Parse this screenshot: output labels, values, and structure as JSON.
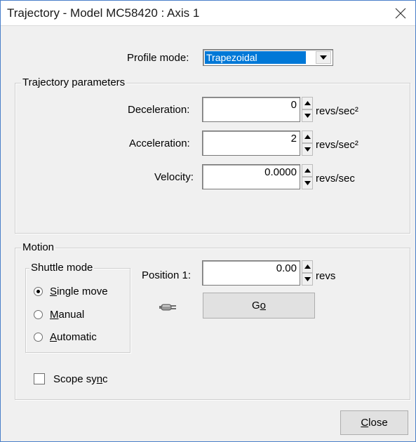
{
  "window": {
    "title": "Trajectory - Model MC58420 :  Axis 1",
    "close_glyph": "✕",
    "accent_color": "#0078d7"
  },
  "profile": {
    "label": "Profile mode:",
    "value": "Trapezoidal",
    "dropdown_icon": "chevron-down-icon"
  },
  "trajectory": {
    "group_title": "Trajectory parameters",
    "deceleration": {
      "label": "Deceleration:",
      "value": "0",
      "unit": "revs/sec²"
    },
    "acceleration": {
      "label": "Acceleration:",
      "value": "2",
      "unit": "revs/sec²"
    },
    "velocity": {
      "label": "Velocity:",
      "value": "0.0000",
      "unit": "revs/sec"
    }
  },
  "motion": {
    "group_title": "Motion",
    "shuttle": {
      "group_title": "Shuttle mode",
      "options": [
        {
          "pre": "",
          "key": "S",
          "post": "ingle move",
          "checked": true
        },
        {
          "pre": "",
          "key": "M",
          "post": "anual",
          "checked": false
        },
        {
          "pre": "",
          "key": "A",
          "post": "utomatic",
          "checked": false
        }
      ]
    },
    "position": {
      "label": "Position 1:",
      "value": "0.00",
      "unit": "revs"
    },
    "status_icon": "plug-icon",
    "go": {
      "pre": "G",
      "key": "o",
      "post": ""
    },
    "scope_sync": {
      "pre": "Scope sy",
      "key": "n",
      "post": "c",
      "checked": false
    }
  },
  "footer": {
    "close": {
      "pre": "",
      "key": "C",
      "post": "lose"
    }
  }
}
